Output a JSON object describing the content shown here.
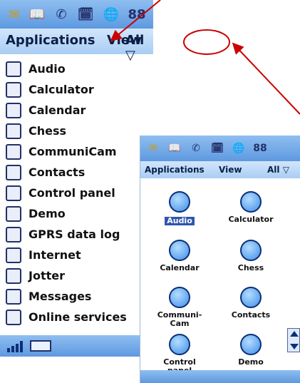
{
  "big": {
    "menu": {
      "applications": "Applications",
      "view": "View",
      "all": "All ▽"
    },
    "list": [
      "Audio",
      "Calculator",
      "Calendar",
      "Chess",
      "CommuniCam",
      "Contacts",
      "Control panel",
      "Demo",
      "GPRS data log",
      "Internet",
      "Jotter",
      "Messages",
      "Online services"
    ]
  },
  "small": {
    "menu": {
      "applications": "Applications",
      "view": "View",
      "all": "All ▽"
    },
    "tiles": [
      "Audio",
      "Calculator",
      "Calendar",
      "Chess",
      "Communi-\nCam",
      "Contacts",
      "Control\npanel",
      "Demo"
    ]
  },
  "colors": {
    "accent": "#2f56ad",
    "menubar": "#a9cdf4",
    "titlebar": "#5e99e0",
    "annotation": "#cc0000"
  }
}
